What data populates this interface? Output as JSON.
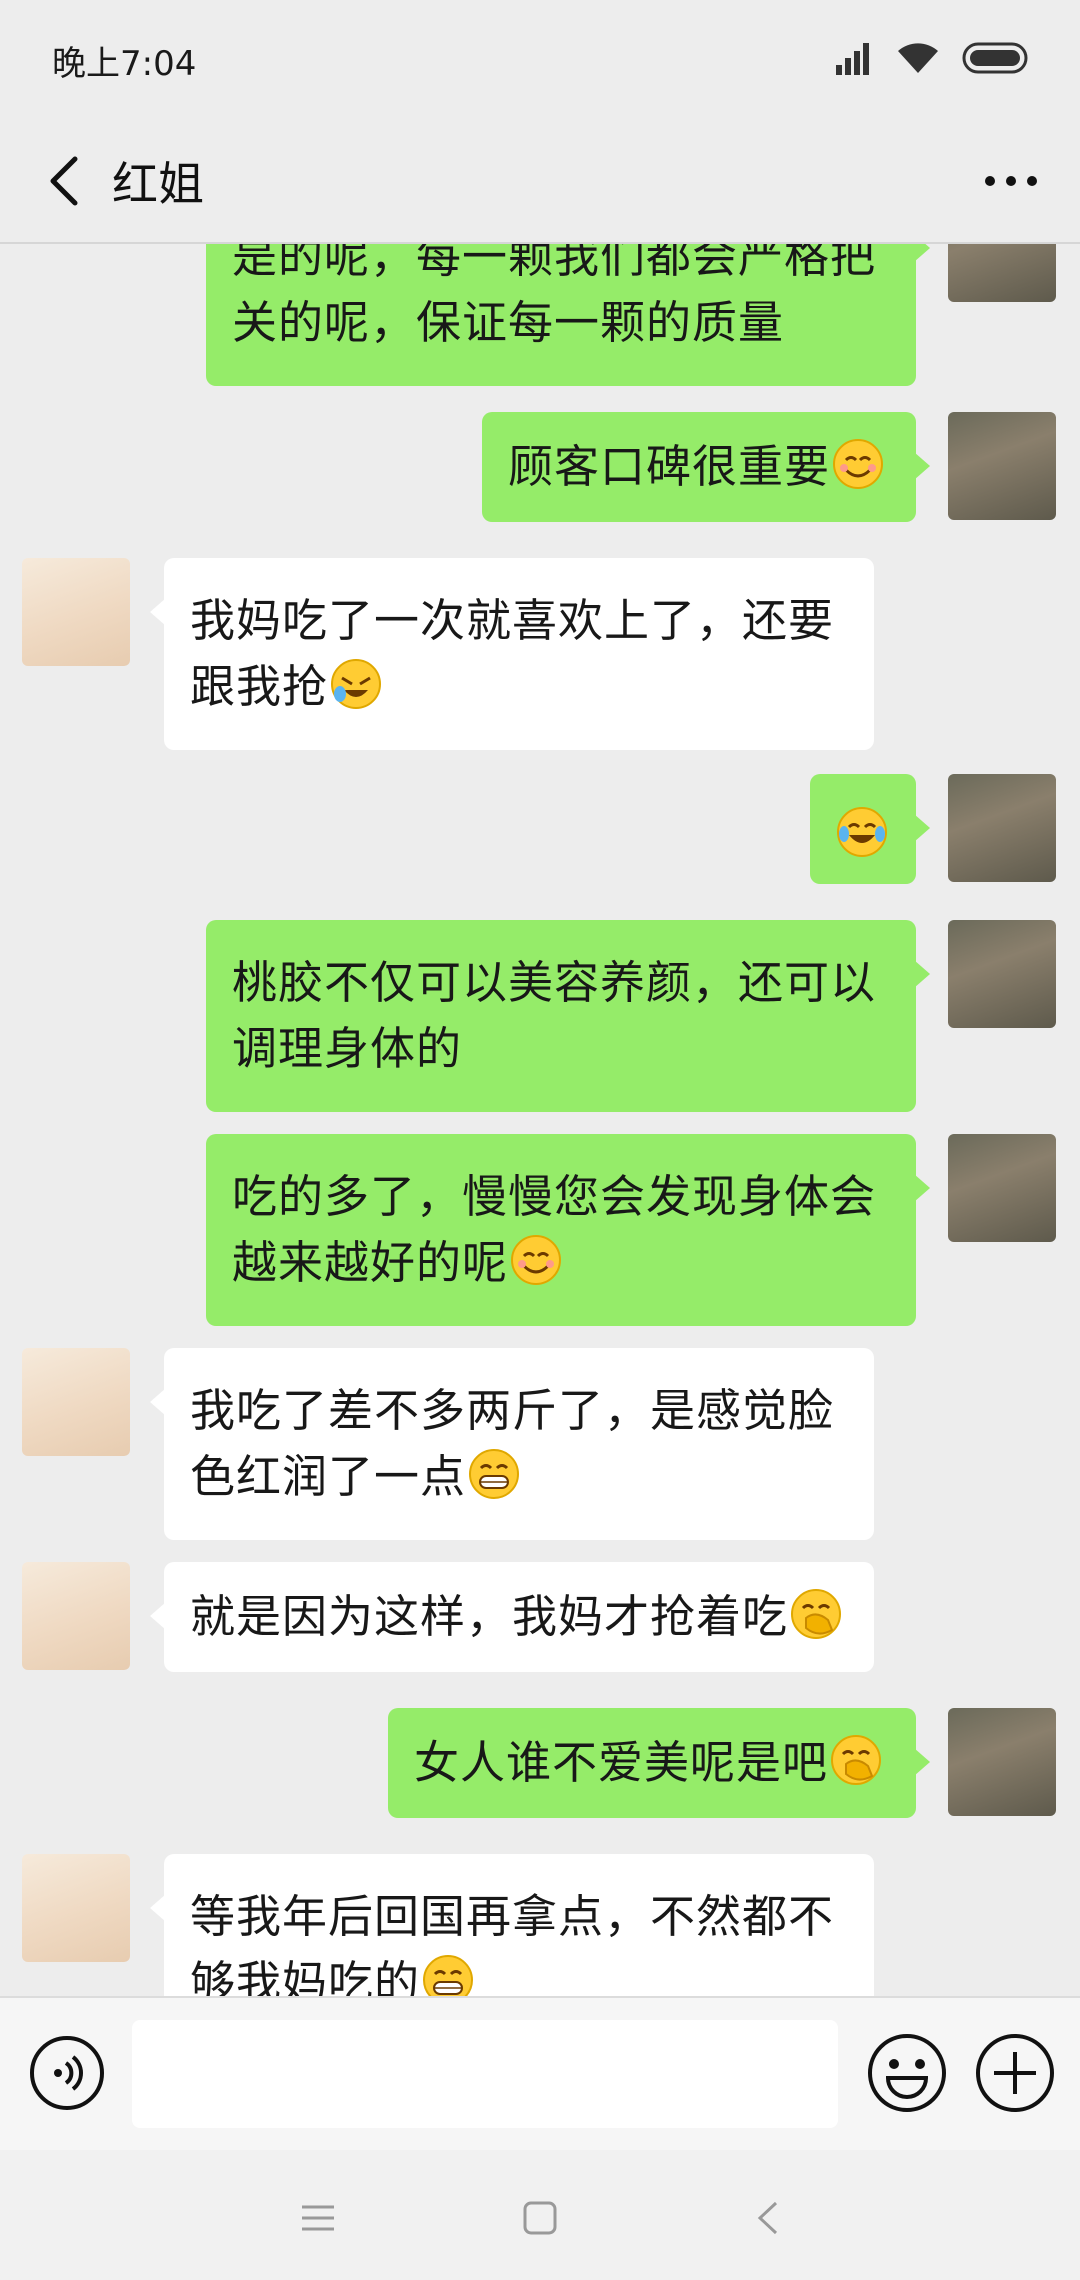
{
  "status": {
    "time": "晚上7:04"
  },
  "header": {
    "title": "红姐"
  },
  "messages": [
    {
      "side": "out",
      "text": "是的呢，每一颗我们都会严格把关的呢，保证每一颗的质量",
      "emoji": ""
    },
    {
      "side": "out",
      "text": "顾客口碑很重要",
      "emoji": "smiling-face"
    },
    {
      "side": "in",
      "text": "我妈吃了一次就喜欢上了，还要跟我抢",
      "emoji": "laughing-crying-face"
    },
    {
      "side": "out",
      "text": "",
      "emoji": "tears-of-joy-face"
    },
    {
      "side": "out",
      "text": "桃胶不仅可以美容养颜，还可以调理身体的",
      "emoji": ""
    },
    {
      "side": "out",
      "text": "吃的多了，慢慢您会发现身体会越来越好的呢",
      "emoji": "smiling-face"
    },
    {
      "side": "in",
      "text": "我吃了差不多两斤了，是感觉脸色红润了一点",
      "emoji": "grinning-face"
    },
    {
      "side": "in",
      "text": "就是因为这样，我妈才抢着吃",
      "emoji": "hand-over-mouth-face"
    },
    {
      "side": "out",
      "text": "女人谁不爱美呢是吧",
      "emoji": "hand-over-mouth-face"
    },
    {
      "side": "in",
      "text": "等我年后回国再拿点，不然都不够我妈吃的",
      "emoji": "grinning-face"
    }
  ],
  "input": {
    "value": "",
    "placeholder": ""
  },
  "colors": {
    "outgoing_bubble": "#95ec69",
    "incoming_bubble": "#ffffff",
    "background": "#ededed"
  }
}
